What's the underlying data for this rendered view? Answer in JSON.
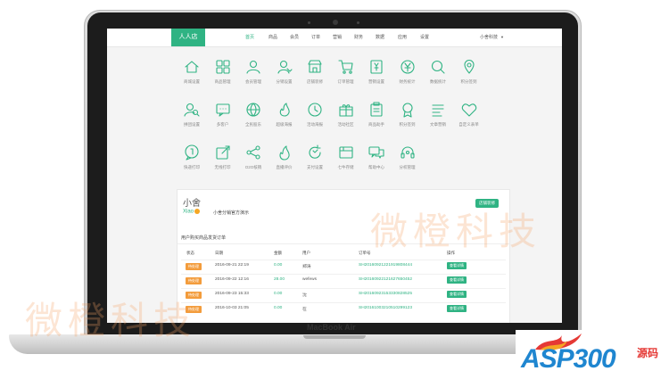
{
  "laptop": {
    "model_label": "MacBook Air"
  },
  "topbar": {
    "brand": "人人店",
    "nav": [
      "首页",
      "商品",
      "会员",
      "订单",
      "营销",
      "财务",
      "数据",
      "应用",
      "设置"
    ],
    "active_index": 0,
    "user": "小舍科技"
  },
  "icons": [
    {
      "label": "商城设置",
      "icon": "home-icon"
    },
    {
      "label": "商品管理",
      "icon": "grid-icon"
    },
    {
      "label": "会员管理",
      "icon": "user-icon"
    },
    {
      "label": "分销设置",
      "icon": "users-icon"
    },
    {
      "label": "店铺装修",
      "icon": "shop-icon"
    },
    {
      "label": "订单管理",
      "icon": "cart-icon"
    },
    {
      "label": "营销设置",
      "icon": "coupon-icon"
    },
    {
      "label": "财务统计",
      "icon": "yen-icon"
    },
    {
      "label": "数据统计",
      "icon": "search-icon"
    },
    {
      "label": "积分签到",
      "icon": "location-icon"
    },
    {
      "label": "拼团设置",
      "icon": "user-search-icon"
    },
    {
      "label": "多客户",
      "icon": "chat-icon"
    },
    {
      "label": "全民股东",
      "icon": "globe-icon"
    },
    {
      "label": "超级海报",
      "icon": "flame-icon"
    },
    {
      "label": "活动海报",
      "icon": "clock-icon"
    },
    {
      "label": "活动社区",
      "icon": "gift-icon"
    },
    {
      "label": "商品助手",
      "icon": "clipboard-icon"
    },
    {
      "label": "积分签到",
      "icon": "badge-icon"
    },
    {
      "label": "文章营销",
      "icon": "list-icon"
    },
    {
      "label": "自定义表单",
      "icon": "heart-icon"
    },
    {
      "label": "快递打印",
      "icon": "chat-bubble-icon"
    },
    {
      "label": "无线打印",
      "icon": "share-edit-icon"
    },
    {
      "label": "O2O核销",
      "icon": "share-icon"
    },
    {
      "label": "直播评价",
      "icon": "flame-alt-icon"
    },
    {
      "label": "支付设置",
      "icon": "refresh-icon"
    },
    {
      "label": "七牛存储",
      "icon": "cloud-icon"
    },
    {
      "label": "帮助中心",
      "icon": "chat-double-icon"
    },
    {
      "label": "分权管理",
      "icon": "headset-icon"
    }
  ],
  "panel": {
    "logo_cn": "小舍",
    "logo_en": "Xiao",
    "shop_name": "小舍分销官方演示",
    "edit_button": "店铺装修",
    "section_title": "用户购买商品发货订单",
    "columns": [
      "状态",
      "日期",
      "金额",
      "用户",
      "订单号",
      "操作"
    ],
    "rows": [
      {
        "status": "待处理",
        "date": "2016-09-21 22:19",
        "amount": "0.00",
        "user": "郑涛",
        "order_no": "SH20160921221919808444",
        "action": "查看详情"
      },
      {
        "status": "待处理",
        "date": "2016-09-22 12:16",
        "amount": "28.00",
        "user": "wefews",
        "order_no": "SH20160922121627650452",
        "action": "查看详情"
      },
      {
        "status": "待处理",
        "date": "2016-09-23 15:33",
        "amount": "0.00",
        "user": "沈",
        "order_no": "SH20160923153330828525",
        "action": "查看详情"
      },
      {
        "status": "待处理",
        "date": "2016-10-03 21:05",
        "amount": "0.00",
        "user": "在",
        "order_no": "SH20161003210510299123",
        "action": "查看详情"
      }
    ]
  },
  "watermark": "微橙科技",
  "footer_logo": {
    "text_main": "ASP300",
    "text_cn": "源码"
  },
  "colors": {
    "accent": "#2fb383",
    "status": "#f39c3c",
    "watermark": "#f4a064",
    "logo_blue": "#1f86d0",
    "logo_red": "#e53935"
  }
}
